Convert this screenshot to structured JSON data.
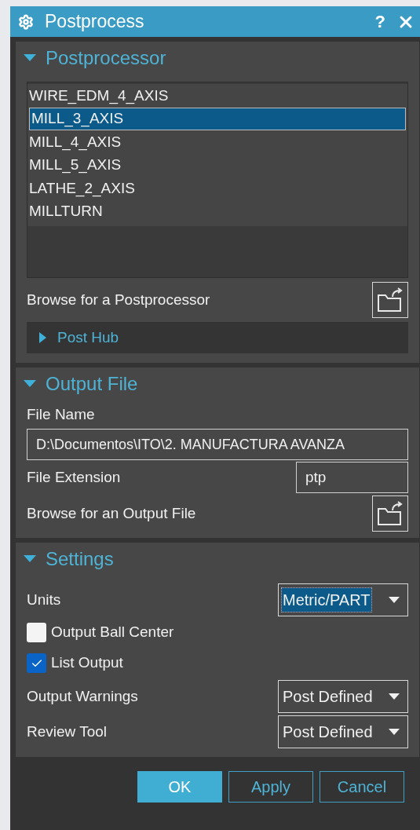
{
  "window": {
    "title": "Postprocess",
    "help": "?"
  },
  "postprocessor": {
    "title": "Postprocessor",
    "expanded": true,
    "items": [
      {
        "label": "WIRE_EDM_4_AXIS",
        "selected": false
      },
      {
        "label": "MILL_3_AXIS",
        "selected": true
      },
      {
        "label": "MILL_4_AXIS",
        "selected": false
      },
      {
        "label": "MILL_5_AXIS",
        "selected": false
      },
      {
        "label": "LATHE_2_AXIS",
        "selected": false
      },
      {
        "label": "MILLTURN",
        "selected": false
      }
    ],
    "browse_label": "Browse for a Postprocessor",
    "post_hub": {
      "title": "Post Hub",
      "expanded": false
    }
  },
  "output_file": {
    "title": "Output File",
    "expanded": true,
    "file_name_label": "File Name",
    "file_name_value": "D:\\Documentos\\ITO\\2. MANUFACTURA AVANZA",
    "file_extension_label": "File Extension",
    "file_extension_value": "ptp",
    "browse_label": "Browse for an Output File"
  },
  "settings": {
    "title": "Settings",
    "expanded": true,
    "rows": [
      {
        "kind": "dropdown",
        "label": "Units",
        "value": "Metric/PART",
        "focused": true
      },
      {
        "kind": "checkbox",
        "label": "Output Ball Center",
        "checked": false
      },
      {
        "kind": "checkbox",
        "label": "List Output",
        "checked": true
      },
      {
        "kind": "dropdown",
        "label": "Output Warnings",
        "value": "Post Defined",
        "focused": false
      },
      {
        "kind": "dropdown",
        "label": "Review Tool",
        "value": "Post Defined",
        "focused": false
      }
    ]
  },
  "buttons": [
    {
      "label": "OK",
      "kind": "primary"
    },
    {
      "label": "Apply",
      "kind": "secondary"
    },
    {
      "label": "Cancel",
      "kind": "secondary"
    }
  ]
}
